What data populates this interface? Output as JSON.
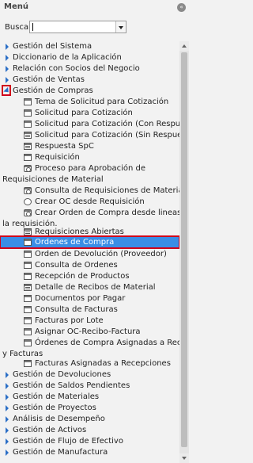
{
  "header": {
    "title": "Menú",
    "collapse_icon": "double-chevron-left-icon"
  },
  "search": {
    "label": "Buscar:",
    "value": ""
  },
  "tree": {
    "top_items": [
      "Gestión del Sistema",
      "Diccionario de la Aplicación",
      "Relación con Socios del Negocio",
      "Gestión de Ventas",
      "Gestión de Compras"
    ],
    "compras_children": [
      "Tema de Solicitud para Cotización",
      "Solicitud para Cotización",
      "Solicitud para Cotización (Con Respuesta)",
      "Solicitud para Cotización (Sin Respuesta)",
      "Respuesta SpC",
      "Requisición",
      "Proceso para Aprobación de",
      "Requisiciones de Material",
      "Consulta de Requisiciones de Material",
      "Crear OC desde Requisición",
      "Crear Orden de Compra desde lineas de",
      "la requisición.",
      "Requisiciones Abiertas",
      "Ordenes de Compra",
      "Orden de Devolución (Proveedor)",
      "Consulta de Ordenes",
      "Recepción de Productos",
      "Detalle de Recibos de Material",
      "Documentos por Pagar",
      "Consulta de Facturas",
      "Facturas por Lote",
      "Asignar OC-Recibo-Factura",
      "Órdenes de Compra Asignadas a Recibos",
      "y Facturas",
      "Facturas Asignadas a Recepciones"
    ],
    "bottom_items": [
      "Gestión de Devoluciones",
      "Gestión de Saldos Pendientes",
      "Gestión de Materiales",
      "Gestión de Proyectos",
      "Análisis de Desempeño",
      "Gestión de Activos",
      "Gestión de Flujo de Efectivo",
      "Gestión de Manufactura"
    ]
  },
  "colors": {
    "selected": "#3a8ee6",
    "highlight_box": "#d0021b",
    "arrow": "#2a6ec6"
  }
}
